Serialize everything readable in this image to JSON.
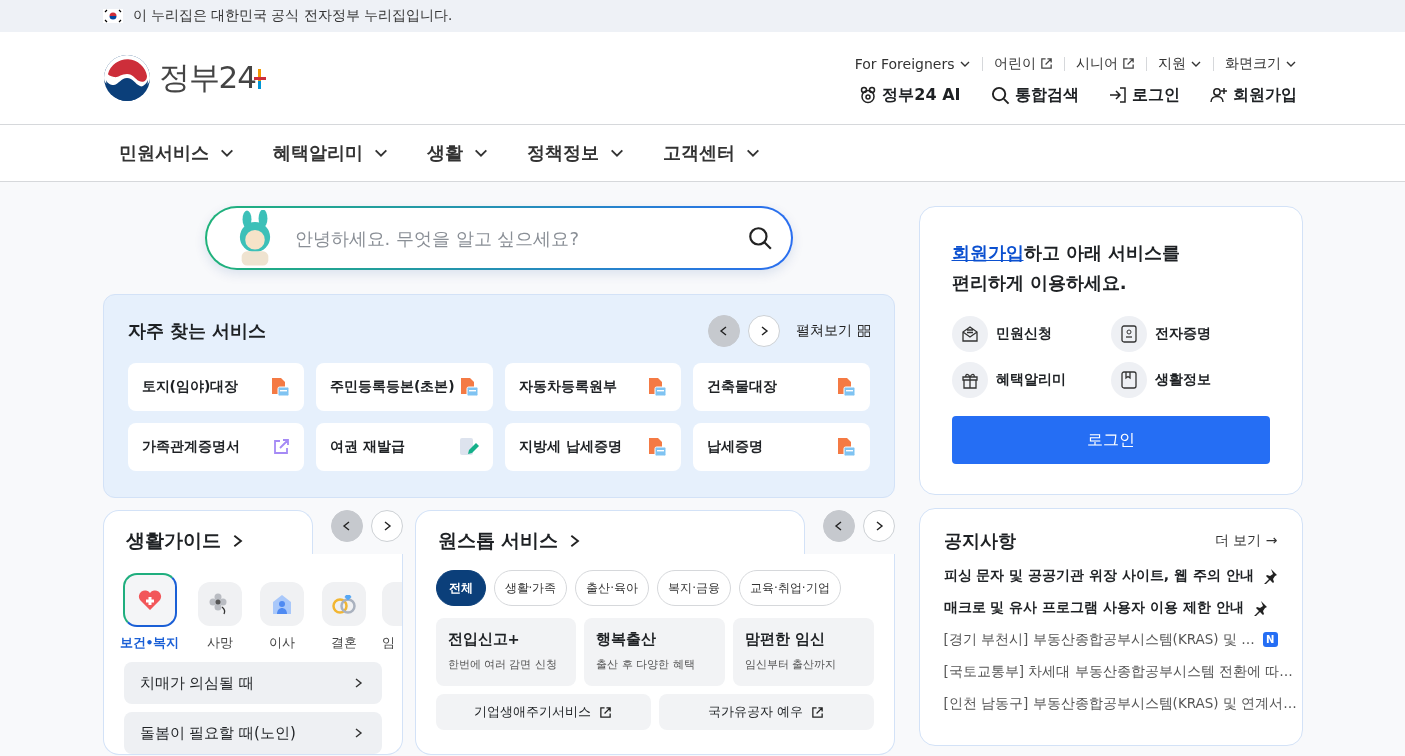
{
  "banner": {
    "text": "이 누리집은 대한민국 공식 전자정부 누리집입니다."
  },
  "header": {
    "logo": "정부24",
    "utility_links": [
      {
        "label": "For Foreigners",
        "kind": "dropdown"
      },
      {
        "label": "어린이",
        "kind": "external"
      },
      {
        "label": "시니어",
        "kind": "external"
      },
      {
        "label": "지원",
        "kind": "dropdown"
      },
      {
        "label": "화면크기",
        "kind": "dropdown"
      }
    ],
    "actions": [
      {
        "label": "정부24 AI",
        "kind": "ai"
      },
      {
        "label": "통합검색",
        "kind": "search"
      },
      {
        "label": "로그인",
        "kind": "login"
      },
      {
        "label": "회원가입",
        "kind": "signup"
      }
    ]
  },
  "nav": [
    {
      "label": "민원서비스"
    },
    {
      "label": "혜택알리미"
    },
    {
      "label": "생활"
    },
    {
      "label": "정책정보"
    },
    {
      "label": "고객센터"
    }
  ],
  "search": {
    "placeholder": "안녕하세요. 무엇을 알고 싶으세요?"
  },
  "frequent": {
    "title": "자주 찾는 서비스",
    "expand": "펼쳐보기",
    "pager": [
      {
        "kind": "prev",
        "disabled": true
      },
      {
        "kind": "next",
        "disabled": false
      }
    ],
    "items": [
      {
        "label": "토지(임야)대장",
        "kind": "pdf"
      },
      {
        "label": "주민등록등본(초본)",
        "kind": "pdf"
      },
      {
        "label": "자동차등록원부",
        "kind": "pdf"
      },
      {
        "label": "건축물대장",
        "kind": "pdf"
      },
      {
        "label": "가족관계증명서",
        "kind": "external"
      },
      {
        "label": "여권 재발급",
        "kind": "edit"
      },
      {
        "label": "지방세 납세증명",
        "kind": "pdf"
      },
      {
        "label": "납세증명",
        "kind": "pdf"
      }
    ]
  },
  "life_guide": {
    "title": "생활가이드",
    "pager": [
      {
        "kind": "prev",
        "disabled": true
      },
      {
        "kind": "next",
        "disabled": false
      }
    ],
    "categories": [
      {
        "label": "보건•복지",
        "kind": "health",
        "selected": true
      },
      {
        "label": "사망",
        "kind": "death",
        "selected": false
      },
      {
        "label": "이사",
        "kind": "move",
        "selected": false
      },
      {
        "label": "결혼",
        "kind": "marriage",
        "selected": false
      },
      {
        "label": "임",
        "kind": "pregnancy",
        "selected": false
      }
    ],
    "items": [
      "치매가 의심될 때",
      "돌봄이 필요할 때(노인)"
    ]
  },
  "one_stop": {
    "title": "원스톱 서비스",
    "pager": [
      {
        "kind": "prev",
        "disabled": true
      },
      {
        "kind": "next",
        "disabled": false
      }
    ],
    "filters": [
      {
        "label": "전체",
        "selected": true
      },
      {
        "label": "생활·가족",
        "selected": false
      },
      {
        "label": "출산·육아",
        "selected": false
      },
      {
        "label": "복지·금융",
        "selected": false
      },
      {
        "label": "교육·취업·기업",
        "selected": false
      }
    ],
    "cards": [
      {
        "title": "전입신고+",
        "description": "한번에 여러 감면 신청"
      },
      {
        "title": "행복출산",
        "description": "출산 후 다양한 혜택"
      },
      {
        "title": "맘편한 임신",
        "description": "임신부터 출산까지"
      }
    ],
    "links": [
      "기업생애주기서비스",
      "국가유공자 예우"
    ]
  },
  "login_card": {
    "signup_link": "회원가입",
    "message": "하고 아래 서비스를 편리하게 이용하세요.",
    "services": [
      {
        "label": "민원신청",
        "kind": "civil"
      },
      {
        "label": "전자증명",
        "kind": "certificate"
      },
      {
        "label": "혜택알리미",
        "kind": "benefit"
      },
      {
        "label": "생활정보",
        "kind": "life"
      }
    ],
    "button": "로그인"
  },
  "notices": {
    "title": "공지사항",
    "more": "더 보기 →",
    "items": [
      {
        "text": "피싱 문자 및 공공기관 위장 사이트, 웹 주의 안내",
        "pinned": true
      },
      {
        "text": "매크로 및 유사 프로그램 사용자 이용 제한 안내",
        "pinned": true
      },
      {
        "text": "[경기 부천시] 부동산종합공부시스템(KRAS) 및 …",
        "pinned": false,
        "badge": "N"
      },
      {
        "text": "[국토교통부] 차세대 부동산종합공부시스템 전환에 따…",
        "pinned": false
      },
      {
        "text": "[인천 남동구] 부동산종합공부시스템(KRAS) 및 연계서…",
        "pinned": false
      }
    ]
  }
}
